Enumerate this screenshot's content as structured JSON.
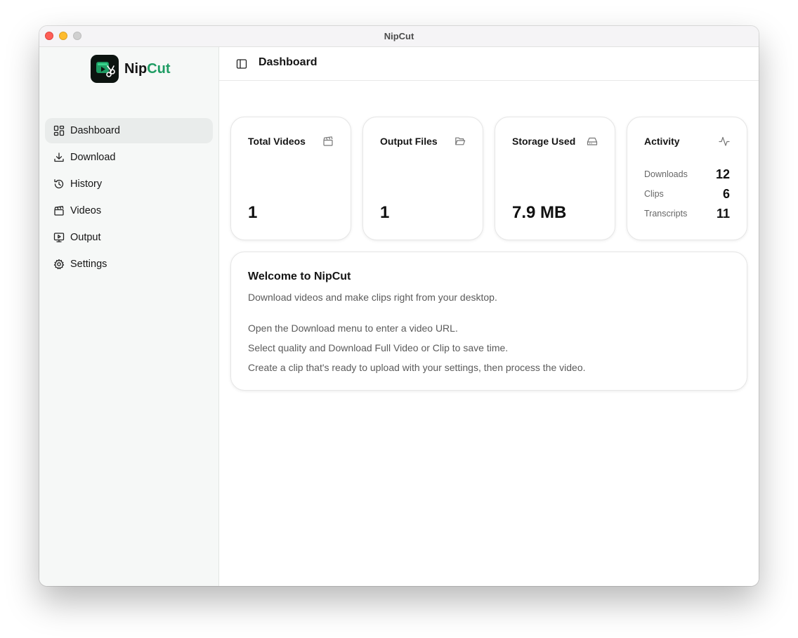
{
  "window": {
    "title": "NipCut"
  },
  "brand": {
    "name_main": "Nip",
    "name_accent": "Cut",
    "accent_color": "#1e9c63"
  },
  "sidebar": {
    "items": [
      {
        "label": "Dashboard",
        "icon": "layout-dashboard-icon",
        "active": true
      },
      {
        "label": "Download",
        "icon": "download-icon",
        "active": false
      },
      {
        "label": "History",
        "icon": "history-icon",
        "active": false
      },
      {
        "label": "Videos",
        "icon": "clapperboard-icon",
        "active": false
      },
      {
        "label": "Output",
        "icon": "monitor-play-icon",
        "active": false
      },
      {
        "label": "Settings",
        "icon": "gear-icon",
        "active": false
      }
    ]
  },
  "header": {
    "title": "Dashboard"
  },
  "stats": [
    {
      "title": "Total Videos",
      "value": "1",
      "icon": "clapperboard-icon"
    },
    {
      "title": "Output Files",
      "value": "1",
      "icon": "folder-open-icon"
    },
    {
      "title": "Storage Used",
      "value": "7.9 MB",
      "icon": "hard-drive-icon"
    }
  ],
  "activity": {
    "title": "Activity",
    "icon": "activity-icon",
    "rows": [
      {
        "label": "Downloads",
        "value": "12"
      },
      {
        "label": "Clips",
        "value": "6"
      },
      {
        "label": "Transcripts",
        "value": "11"
      }
    ]
  },
  "welcome": {
    "title": "Welcome to NipCut",
    "subtitle": "Download videos and make clips right from your desktop.",
    "steps": [
      "Open the Download menu to enter a video URL.",
      "Select quality and Download Full Video or Clip to save time.",
      "Create a clip that's ready to upload with your settings, then process the video."
    ]
  }
}
